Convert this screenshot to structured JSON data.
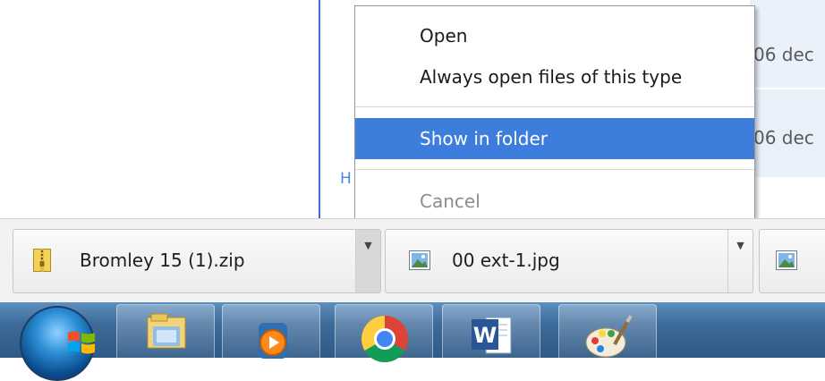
{
  "background": {
    "date_1": "06 dec",
    "date_2": "06 dec",
    "link_fragment": "H"
  },
  "context_menu": {
    "items": [
      {
        "label": "Open",
        "enabled": true,
        "highlighted": false
      },
      {
        "label": "Always open files of this type",
        "enabled": true,
        "highlighted": false
      },
      {
        "label": "Show in folder",
        "enabled": true,
        "highlighted": true
      },
      {
        "label": "Cancel",
        "enabled": false,
        "highlighted": false
      }
    ],
    "highlight_color": "#3d7ddb"
  },
  "download_shelf": {
    "items": [
      {
        "name": "Bromley 15 (1).zip",
        "icon": "zip-file-icon",
        "menu_open": true
      },
      {
        "name": "00 ext-1.jpg",
        "icon": "image-file-icon",
        "menu_open": false
      },
      {
        "name": "",
        "icon": "image-file-icon",
        "menu_open": false
      }
    ]
  },
  "taskbar": {
    "start": "windows-start-orb",
    "pinned": [
      {
        "icon": "folder-explorer-icon"
      },
      {
        "icon": "media-player-icon"
      },
      {
        "icon": "chrome-icon"
      },
      {
        "icon": "word-icon"
      },
      {
        "icon": "paint-icon"
      }
    ]
  }
}
